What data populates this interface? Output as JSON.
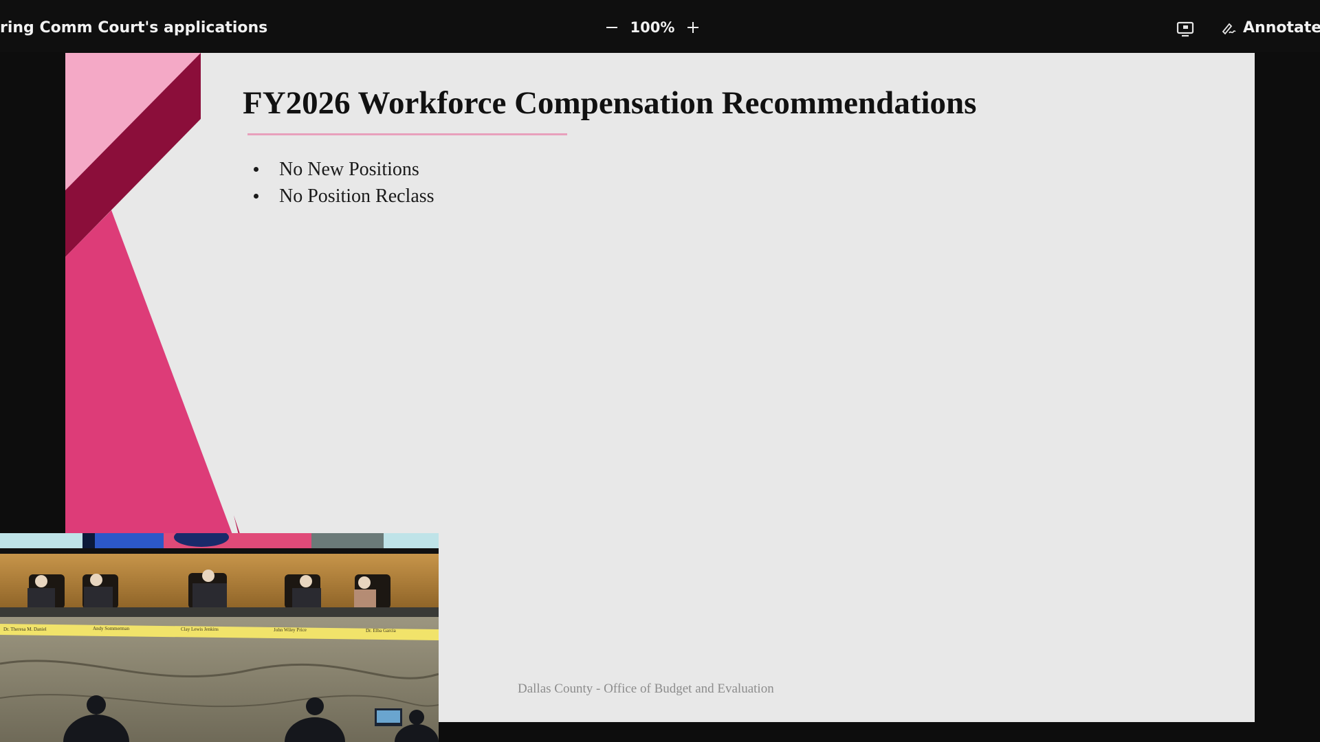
{
  "topbar": {
    "share_title": "ring Comm Court's applications",
    "zoom_level": "100%",
    "annotate_label": "Annotate"
  },
  "slide": {
    "title": "FY2026 Workforce Compensation Recommendations",
    "bullets": [
      "No New Positions",
      "No Position Reclass"
    ],
    "footer": "Dallas County - Office of Budget and Evaluation"
  },
  "video": {
    "nameplates": [
      "Dr. Theresa M. Daniel",
      "Andy Sommerman",
      "Clay Lewis Jenkins",
      "John Wiley Price",
      "Dr. Elba Garcia"
    ]
  },
  "colors": {
    "accent_pink": "#dd3c78",
    "accent_light_pink": "#f4a9c6",
    "accent_maroon": "#8b0e3a",
    "rule_pink": "#e8a0bc"
  }
}
